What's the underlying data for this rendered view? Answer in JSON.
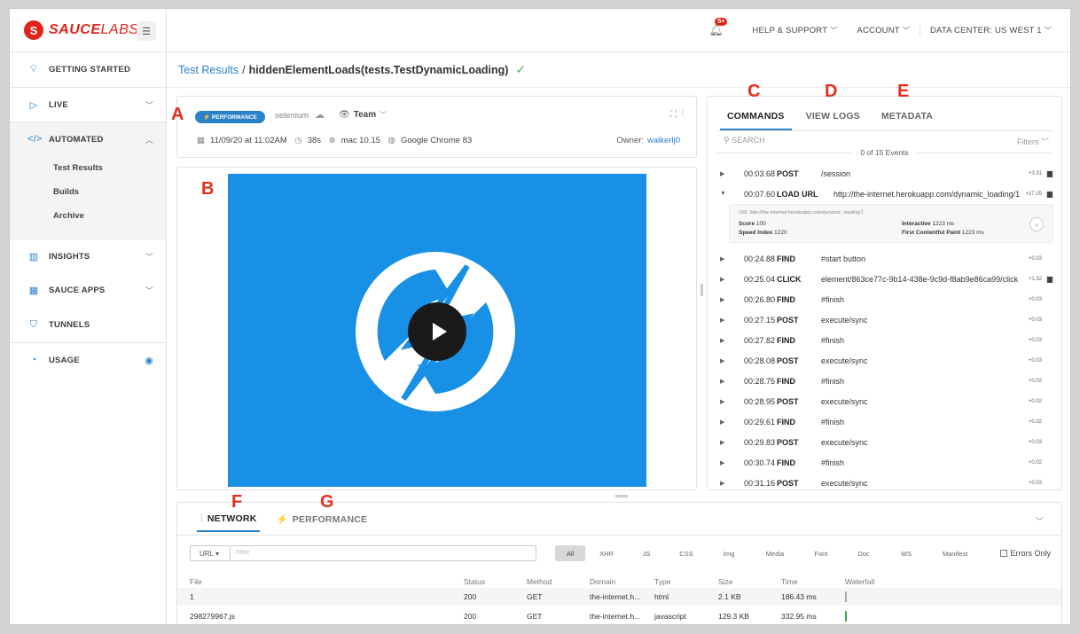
{
  "brand": {
    "name_bold": "SAUCE",
    "name_light": "LABS",
    "mark": "S"
  },
  "sidebar": {
    "items": [
      {
        "label": "GETTING STARTED"
      },
      {
        "label": "LIVE"
      },
      {
        "label": "AUTOMATED"
      },
      {
        "label": "INSIGHTS"
      },
      {
        "label": "SAUCE APPS"
      },
      {
        "label": "TUNNELS"
      },
      {
        "label": "USAGE"
      }
    ],
    "sub_items": [
      {
        "label": "Test Results"
      },
      {
        "label": "Builds"
      },
      {
        "label": "Archive"
      }
    ],
    "automated_icon": "</>"
  },
  "topbar": {
    "badge": "5+",
    "help": "HELP & SUPPORT",
    "account": "ACCOUNT",
    "datacenter": "DATA CENTER: US WEST 1"
  },
  "breadcrumb": {
    "root": "Test Results",
    "separator": "/",
    "test_name": "hiddenElementLoads(tests.TestDynamicLoading)",
    "status": "✓"
  },
  "test_info": {
    "badge": "PERFORMANCE",
    "framework": "selenium",
    "visibility": "Team",
    "date": "11/09/20 at 11:02AM",
    "duration": "38s",
    "os": "mac 10.15",
    "browser": "Google Chrome 83",
    "owner_label": "Owner:",
    "owner": "walkerlj0"
  },
  "annotations": {
    "a": "A",
    "b": "B",
    "c": "C",
    "d": "D",
    "e": "E",
    "f": "F",
    "g": "G"
  },
  "commands_panel": {
    "tabs": [
      {
        "label": "COMMANDS"
      },
      {
        "label": "VIEW LOGS"
      },
      {
        "label": "METADATA"
      }
    ],
    "search_placeholder": "SEARCH",
    "filters": "Filters",
    "events": "0 of 15 Events",
    "commands": [
      {
        "time": "00:03.68",
        "verb": "POST",
        "arg": "/session",
        "dur": "+3.31"
      },
      {
        "time": "00:07.60",
        "verb": "LOAD URL",
        "arg": "http://the-internet.herokuapp.com/dynamic_loading/1",
        "dur": "+17.05"
      },
      {
        "time": "00:24.88",
        "verb": "FIND",
        "arg": "#start button",
        "dur": "+0.03"
      },
      {
        "time": "00:25.04",
        "verb": "CLICK",
        "arg": "element/863ce77c-9b14-438e-9c9d-f8ab9e86ca99/click",
        "dur": "+1.32"
      },
      {
        "time": "00:26.80",
        "verb": "FIND",
        "arg": "#finish",
        "dur": "+0.03"
      },
      {
        "time": "00:27.15",
        "verb": "POST",
        "arg": "execute/sync",
        "dur": "+0.03"
      },
      {
        "time": "00:27.82",
        "verb": "FIND",
        "arg": "#finish",
        "dur": "+0.03"
      },
      {
        "time": "00:28.08",
        "verb": "POST",
        "arg": "execute/sync",
        "dur": "+0.03"
      },
      {
        "time": "00:28.75",
        "verb": "FIND",
        "arg": "#finish",
        "dur": "+0.02"
      },
      {
        "time": "00:28.95",
        "verb": "POST",
        "arg": "execute/sync",
        "dur": "+0.02"
      },
      {
        "time": "00:29.61",
        "verb": "FIND",
        "arg": "#finish",
        "dur": "+0.02"
      },
      {
        "time": "00:29.83",
        "verb": "POST",
        "arg": "execute/sync",
        "dur": "+0.03"
      },
      {
        "time": "00:30.74",
        "verb": "FIND",
        "arg": "#finish",
        "dur": "+0.02"
      },
      {
        "time": "00:31.16",
        "verb": "POST",
        "arg": "execute/sync",
        "dur": "+0.03"
      }
    ],
    "url_details": {
      "url_label": "URL",
      "url": "http://the-internet.herokuapp.com/dynamic_loading/1",
      "score_label": "Score",
      "score": "100",
      "speed_label": "Speed Index",
      "speed": "1220",
      "interactive_label": "Interactive",
      "interactive": "1223 ms",
      "fcp_label": "First Contentful Paint",
      "fcp": "1223 ms"
    }
  },
  "network": {
    "tabs": [
      {
        "label": "NETWORK"
      },
      {
        "label": "PERFORMANCE"
      }
    ],
    "url_select": "URL",
    "filter_placeholder": "Filter",
    "types": [
      "All",
      "XHR",
      "JS",
      "CSS",
      "Img",
      "Media",
      "Font",
      "Doc",
      "WS",
      "Manifest"
    ],
    "errors_only": "Errors Only",
    "columns": [
      "File",
      "Status",
      "Method",
      "Domain",
      "Type",
      "Size",
      "Time",
      "Waterfall"
    ],
    "rows": [
      {
        "file": "1",
        "status": "200",
        "method": "GET",
        "domain": "the-internet.h...",
        "type": "html",
        "size": "2.1 KB",
        "time": "186.43 ms",
        "color": "#aaaaaa"
      },
      {
        "file": "298279967.js",
        "status": "200",
        "method": "GET",
        "domain": "the-internet.h...",
        "type": "javascript",
        "size": "129.3 KB",
        "time": "332.95 ms",
        "color": "#2bb24c"
      }
    ]
  }
}
